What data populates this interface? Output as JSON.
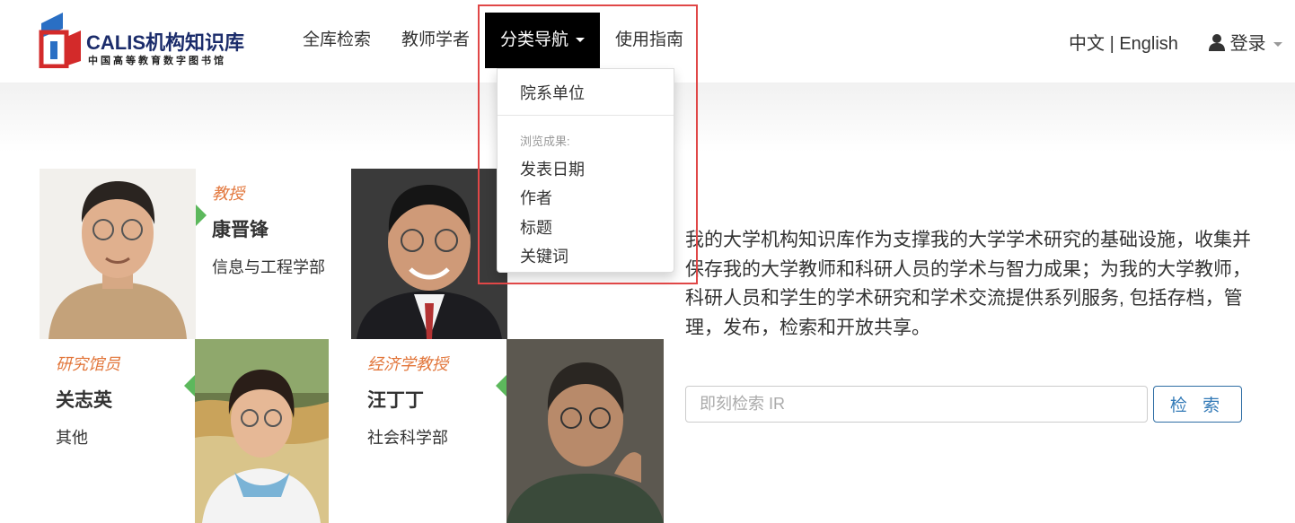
{
  "header": {
    "logo_title": "CALIS机构知识库",
    "logo_subtitle": "中国高等教育数字图书馆",
    "nav": [
      {
        "label": "全库检索"
      },
      {
        "label": "教师学者"
      },
      {
        "label": "分类导航"
      },
      {
        "label": "使用指南"
      }
    ],
    "lang_zh": "中文",
    "lang_sep": "|",
    "lang_en": "English",
    "login_label": "登录"
  },
  "dropdown": {
    "first_item": "院系单位",
    "section_header": "浏览成果:",
    "items": [
      "发表日期",
      "作者",
      "标题",
      "关键词"
    ]
  },
  "scholars": [
    {
      "title": "教授",
      "name": "康晋锋",
      "dept": "信息与工程学部"
    },
    {
      "title": "研究馆员",
      "name": "关志英",
      "dept": "其他"
    },
    {
      "title": "经济学教授",
      "name": "汪丁丁",
      "dept": "社会科学部"
    }
  ],
  "description": "我的大学机构知识库作为支撑我的大学学术研究的基础设施，收集并保存我的大学教师和科研人员的学术与智力成果；为我的大学教师，科研人员和学生的学术研究和学术交流提供系列服务, 包括存档，管理，发布，检索和开放共享。",
  "search": {
    "placeholder": "即刻检索 IR",
    "button_label": "检 索"
  },
  "colors": {
    "accent": "#337ab7",
    "title_orange": "#e2763b",
    "arrow_green": "#5cb85c",
    "highlight_red": "#e04747",
    "active_nav_bg": "#000000"
  }
}
